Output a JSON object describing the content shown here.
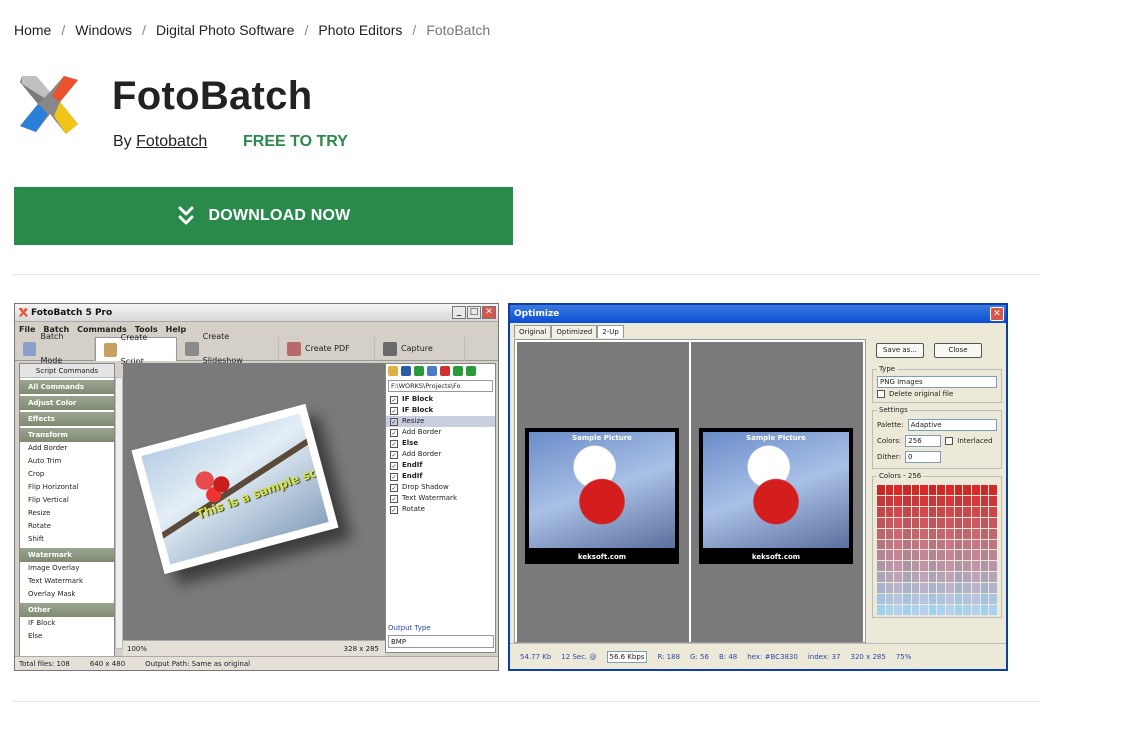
{
  "breadcrumb": {
    "items": [
      "Home",
      "Windows",
      "Digital Photo Software",
      "Photo Editors"
    ],
    "current": "FotoBatch",
    "separator": "/"
  },
  "app": {
    "title": "FotoBatch",
    "by_prefix": "By",
    "publisher": "Fotobatch",
    "license": "FREE TO TRY"
  },
  "download": {
    "label": "DOWNLOAD NOW",
    "color": "#2a8a4b"
  },
  "screenshot1": {
    "window_title": "FotoBatch 5 Pro",
    "menu": [
      "File",
      "Batch",
      "Commands",
      "Tools",
      "Help"
    ],
    "tabs": [
      "Batch Mode",
      "Create Script",
      "Create Slideshow",
      "Create PDF",
      "Capture"
    ],
    "left_header": "Script Commands",
    "categories_top": [
      "All Commands",
      "Adjust Color",
      "Effects",
      "Transform"
    ],
    "transform_items": [
      "Add Border",
      "Auto Trim",
      "Crop",
      "Flip Horizontal",
      "Flip Vertical",
      "Resize",
      "Rotate",
      "Shift"
    ],
    "watermark_cat": "Watermark",
    "watermark_items": [
      "Image Overlay",
      "Text Watermark",
      "Overlay Mask"
    ],
    "other_cat": "Other",
    "other_items": [
      "IF Block",
      "Else"
    ],
    "watermark_text": "This is a sample script",
    "path": "F:\\WORKS\\Projects\\Fo",
    "script_items": [
      {
        "label": "IF Block",
        "bold": true
      },
      {
        "label": "IF Block",
        "bold": true
      },
      {
        "label": "Resize",
        "bold": false,
        "selected": true
      },
      {
        "label": "Add Border",
        "bold": false
      },
      {
        "label": "Else",
        "bold": true
      },
      {
        "label": "Add Border",
        "bold": false
      },
      {
        "label": "EndIf",
        "bold": true
      },
      {
        "label": "EndIf",
        "bold": true
      },
      {
        "label": "Drop Shadow",
        "bold": false
      },
      {
        "label": "Text Watermark",
        "bold": false
      },
      {
        "label": "Rotate",
        "bold": false
      }
    ],
    "output_type_label": "Output Type",
    "output_type_value": "BMP",
    "zoom": "100%",
    "dimensions": "328 x 285",
    "status_total": "Total files: 108",
    "status_size": "640 x 480",
    "status_output": "Output Path: Same as original"
  },
  "screenshot2": {
    "window_title": "Optimize",
    "tabs": [
      "Original",
      "Optimized",
      "2-Up"
    ],
    "sample_text": "Sample Picture",
    "caption": "keksoft.com",
    "save_label": "Save as...",
    "close_label": "Close",
    "type_legend": "Type",
    "type_value": "PNG Images",
    "delete_original": "Delete original file",
    "settings_legend": "Settings",
    "palette_label": "Palette:",
    "palette_value": "Adaptive",
    "colors_label": "Colors:",
    "colors_value": "256",
    "interlaced": "Interlaced",
    "dither_label": "Dither:",
    "dither_value": "0",
    "colors_count": "Colors - 256",
    "status_size": "54.77 Kb",
    "status_time": "12 Sec. @",
    "status_speed": "56.6 Kbps",
    "status_r": "R: 188",
    "status_g": "G: 56",
    "status_b": "B: 48",
    "status_hex": "hex: #BC3830",
    "status_index": "index: 37",
    "status_dims": "320 x 285",
    "status_zoom": "75%"
  }
}
